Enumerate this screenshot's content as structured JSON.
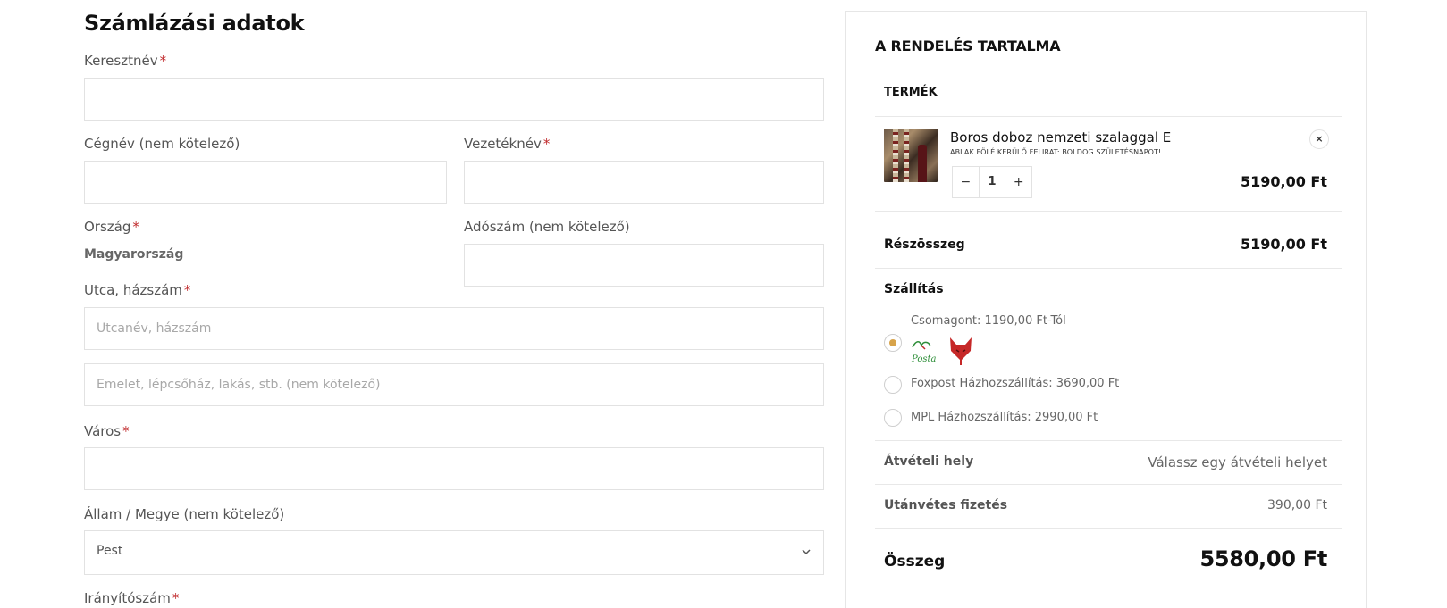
{
  "billing": {
    "title": "Számlázási adatok",
    "required_mark": "*",
    "first_name_label": "Keresztnév",
    "company_label": "Cégnév (nem kötelező)",
    "last_name_label": "Vezetéknév",
    "country_label": "Ország",
    "country_value": "Magyarország",
    "tax_label": "Adószám (nem kötelező)",
    "street_label": "Utca, házszám",
    "street_placeholder": "Utcanév, házszám",
    "street2_placeholder": "Emelet, lépcsőház, lakás, stb. (nem kötelező)",
    "city_label": "Város",
    "state_label": "Állam / Megye (nem kötelező)",
    "state_value": "Pest",
    "zip_label": "Irányítószám"
  },
  "order": {
    "title": "A RENDELÉS TARTALMA",
    "product_header": "TERMÉK",
    "product": {
      "name": "Boros doboz nemzeti szalaggal E",
      "meta": "ABLAK FÖLÉ KERÜLŐ FELIRAT: BOLDOG SZÜLETÉSNAPOT!",
      "qty": "1",
      "minus": "−",
      "plus": "+",
      "remove": "×",
      "price": "5190,00 Ft"
    },
    "subtotal_label": "Részösszeg",
    "subtotal_value": "5190,00 Ft",
    "shipping_label": "Szállítás",
    "shipping_options": [
      {
        "label": "Csomagont: 1190,00 Ft-Tól",
        "selected": true
      },
      {
        "label": "Foxpost Házhozszállítás: 3690,00 Ft",
        "selected": false
      },
      {
        "label": "MPL Házhozszállítás: 2990,00 Ft",
        "selected": false
      }
    ],
    "pickup_label": "Átvételi hely",
    "pickup_value": "Válassz egy átvételi helyet",
    "cod_label": "Utánvétes fizetés",
    "cod_value": "390,00 Ft",
    "total_label": "Összeg",
    "total_value": "5580,00 Ft"
  },
  "colors": {
    "accent": "#d7a34a",
    "required": "#c0292b",
    "border": "#e2e2e2"
  }
}
